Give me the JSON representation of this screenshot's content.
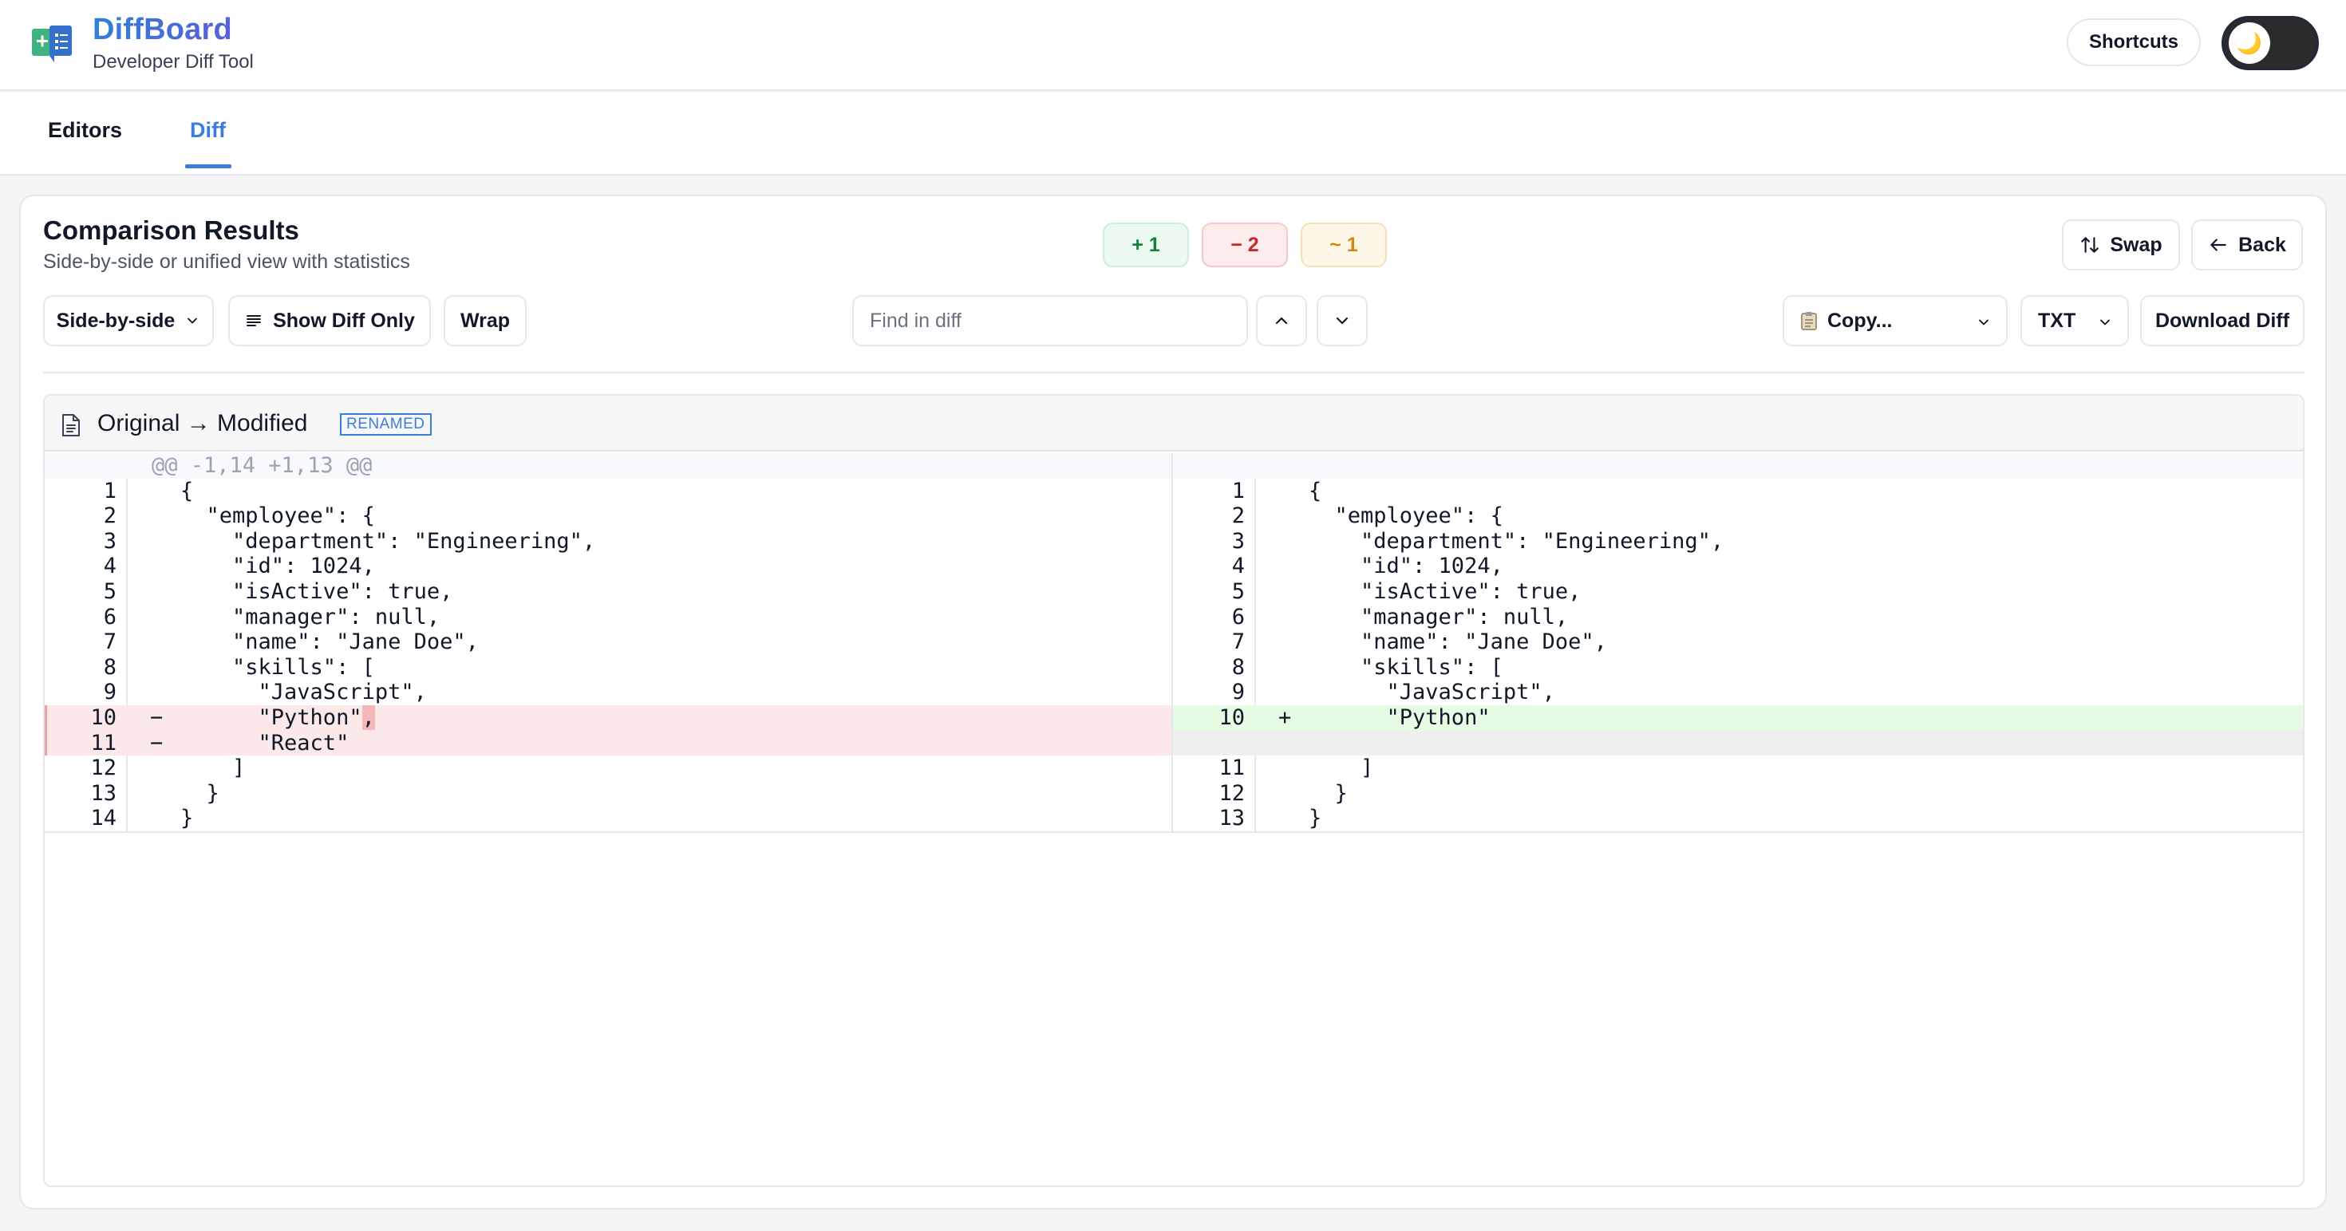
{
  "app": {
    "title": "DiffBoard",
    "subtitle": "Developer Diff Tool",
    "shortcuts_label": "Shortcuts",
    "theme_icon": "🌙"
  },
  "tabs": [
    {
      "label": "Editors",
      "active": false
    },
    {
      "label": "Diff",
      "active": true
    }
  ],
  "results": {
    "title": "Comparison Results",
    "subtitle": "Side-by-side or unified view with statistics",
    "stats": {
      "added": "+ 1",
      "removed": "− 2",
      "modified": "~ 1"
    },
    "swap_label": "Swap",
    "back_label": "Back"
  },
  "toolbar": {
    "view_mode": "Side-by-side",
    "show_diff_only": "Show Diff Only",
    "wrap": "Wrap",
    "search_placeholder": "Find in diff",
    "copy_label": "Copy...",
    "format": "TXT",
    "download_label": "Download Diff"
  },
  "file": {
    "name": "Original → Modified",
    "status": "RENAMED"
  },
  "colors": {
    "accent": "#3b7ddd",
    "added": "#15803d",
    "removed": "#c62828",
    "modified": "#d08a11"
  },
  "diff": {
    "hunk": "@@ -1,14 +1,13 @@",
    "left": [
      {
        "ln": "1",
        "mk": "",
        "code": "{",
        "type": "ctx"
      },
      {
        "ln": "2",
        "mk": "",
        "code": "  \"employee\": {",
        "type": "ctx"
      },
      {
        "ln": "3",
        "mk": "",
        "code": "    \"department\": \"Engineering\",",
        "type": "ctx"
      },
      {
        "ln": "4",
        "mk": "",
        "code": "    \"id\": 1024,",
        "type": "ctx"
      },
      {
        "ln": "5",
        "mk": "",
        "code": "    \"isActive\": true,",
        "type": "ctx"
      },
      {
        "ln": "6",
        "mk": "",
        "code": "    \"manager\": null,",
        "type": "ctx"
      },
      {
        "ln": "7",
        "mk": "",
        "code": "    \"name\": \"Jane Doe\",",
        "type": "ctx"
      },
      {
        "ln": "8",
        "mk": "",
        "code": "    \"skills\": [",
        "type": "ctx"
      },
      {
        "ln": "9",
        "mk": "",
        "code": "      \"JavaScript\",",
        "type": "ctx"
      },
      {
        "ln": "10",
        "mk": "−",
        "code": "      \"Python\"",
        "hl": ",",
        "type": "del"
      },
      {
        "ln": "11",
        "mk": "−",
        "code": "      \"React\"",
        "type": "del"
      },
      {
        "ln": "12",
        "mk": "",
        "code": "    ]",
        "type": "ctx"
      },
      {
        "ln": "13",
        "mk": "",
        "code": "  }",
        "type": "ctx"
      },
      {
        "ln": "14",
        "mk": "",
        "code": "}",
        "type": "ctx"
      }
    ],
    "right": [
      {
        "ln": "1",
        "mk": "",
        "code": "{",
        "type": "ctx"
      },
      {
        "ln": "2",
        "mk": "",
        "code": "  \"employee\": {",
        "type": "ctx"
      },
      {
        "ln": "3",
        "mk": "",
        "code": "    \"department\": \"Engineering\",",
        "type": "ctx"
      },
      {
        "ln": "4",
        "mk": "",
        "code": "    \"id\": 1024,",
        "type": "ctx"
      },
      {
        "ln": "5",
        "mk": "",
        "code": "    \"isActive\": true,",
        "type": "ctx"
      },
      {
        "ln": "6",
        "mk": "",
        "code": "    \"manager\": null,",
        "type": "ctx"
      },
      {
        "ln": "7",
        "mk": "",
        "code": "    \"name\": \"Jane Doe\",",
        "type": "ctx"
      },
      {
        "ln": "8",
        "mk": "",
        "code": "    \"skills\": [",
        "type": "ctx"
      },
      {
        "ln": "9",
        "mk": "",
        "code": "      \"JavaScript\",",
        "type": "ctx"
      },
      {
        "ln": "10",
        "mk": "+",
        "code": "      \"Python\"",
        "type": "add"
      },
      {
        "ln": "",
        "mk": "",
        "code": "",
        "type": "empty"
      },
      {
        "ln": "11",
        "mk": "",
        "code": "    ]",
        "type": "ctx"
      },
      {
        "ln": "12",
        "mk": "",
        "code": "  }",
        "type": "ctx"
      },
      {
        "ln": "13",
        "mk": "",
        "code": "}",
        "type": "ctx"
      }
    ]
  }
}
